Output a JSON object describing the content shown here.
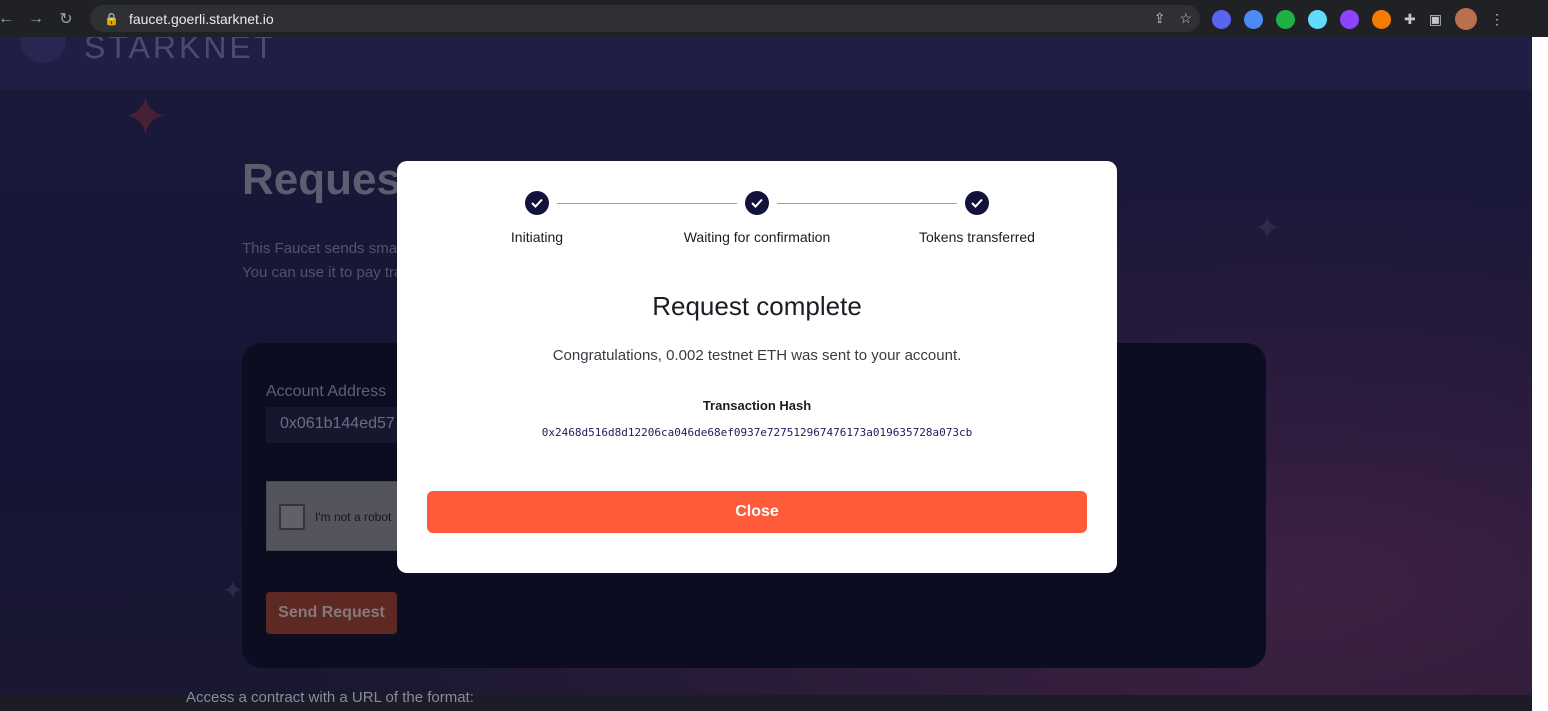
{
  "browser": {
    "url": "faucet.goerli.starknet.io",
    "extension_colors": [
      "#5865f2",
      "#4c8bf5",
      "#1fb141",
      "#61dafb",
      "#8e44ff",
      "#f57c00"
    ]
  },
  "page": {
    "logo_text": "STARKNET",
    "title": "Request Testnet ETH",
    "description_lines": [
      "This Faucet sends small amounts of testnet ETH",
      "You can use it to pay transaction fees"
    ],
    "account_address_label": "Account Address",
    "account_address_value": "0x061b144ed57",
    "captcha_label": "I'm not a robot",
    "send_button": "Send Request",
    "bottom_text": "Access a contract with a URL of the format:"
  },
  "modal": {
    "steps": [
      {
        "label": "Initiating",
        "done": true
      },
      {
        "label": "Waiting for confirmation",
        "done": true
      },
      {
        "label": "Tokens transferred",
        "done": true
      }
    ],
    "title": "Request complete",
    "message": "Congratulations, 0.002 testnet ETH was sent to your account.",
    "hash_label": "Transaction Hash",
    "hash_value": "0x2468d516d8d12206ca046de68ef0937e727512967476173a019635728a073cb",
    "close_button": "Close"
  },
  "colors": {
    "accent": "#ff5a3a",
    "step_dot": "#12123a",
    "page_bg": "#24234f"
  }
}
